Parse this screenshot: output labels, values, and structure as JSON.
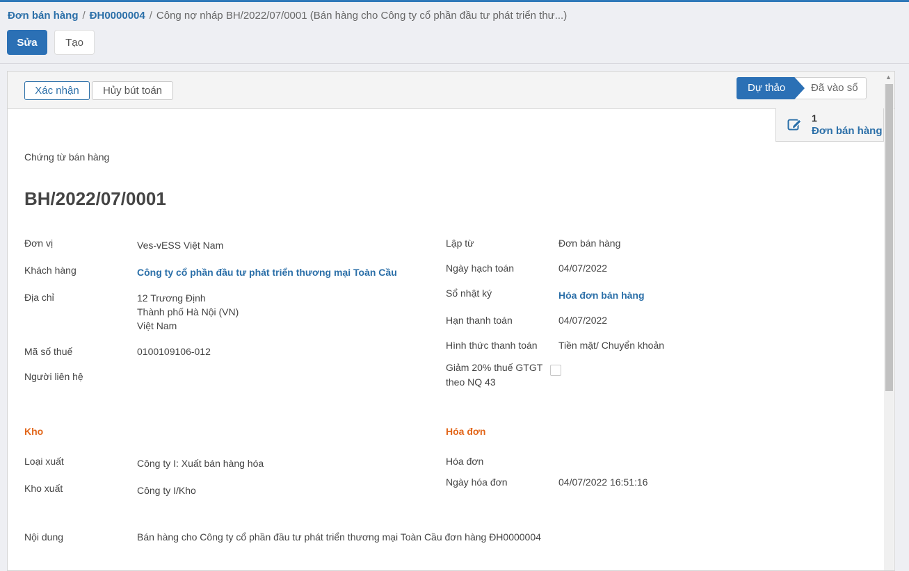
{
  "breadcrumb": {
    "item1": "Đơn bán hàng",
    "item2": "ĐH0000004",
    "current": "Công nợ nháp BH/2022/07/0001 (Bán hàng cho Công ty cổ phần đầu tư phát triển thư...)",
    "separator": "/"
  },
  "toolbar": {
    "edit_label": "Sửa",
    "create_label": "Tạo"
  },
  "statusbar": {
    "confirm_label": "Xác nhận",
    "cancel_label": "Hủy bút toán",
    "stages": {
      "draft": "Dự thảo",
      "posted": "Đã vào sổ"
    },
    "active_stage": "draft"
  },
  "smart_button": {
    "count": "1",
    "label": "Đơn bán hàng",
    "icon": "edit-icon"
  },
  "document": {
    "type_label": "Chứng từ bán hàng",
    "number": "BH/2022/07/0001",
    "left": {
      "unit_label": "Đơn vị",
      "unit_value": "Ves-vESS Việt Nam",
      "customer_label": "Khách hàng",
      "customer_value": "Công ty cổ phần đầu tư phát triển thương mại Toàn Cầu",
      "address_label": "Địa chỉ",
      "address_line1": "12 Trương Định",
      "address_line2": "Thành phố Hà Nội (VN)",
      "address_line3": "Việt Nam",
      "tax_label": "Mã số thuế",
      "tax_value": "0100109106-012",
      "contact_label": "Người liên hệ"
    },
    "right": {
      "created_from_label": "Lập từ",
      "created_from_value": "Đơn bán hàng",
      "accounting_date_label": "Ngày hạch toán",
      "accounting_date_value": "04/07/2022",
      "journal_label": "Sổ nhật ký",
      "journal_value": "Hóa đơn bán hàng",
      "due_date_label": "Hạn thanh toán",
      "due_date_value": "04/07/2022",
      "payment_method_label": "Hình thức thanh toán",
      "payment_method_value": "Tiền mặt/ Chuyển khoản",
      "vat_reduction_line1": "Giảm 20% thuế GTGT",
      "vat_reduction_line2": "theo NQ 43",
      "vat_reduction_checked": false
    },
    "warehouse": {
      "section_title": "Kho",
      "export_type_label": "Loại xuất",
      "export_type_value": "Công ty I: Xuất bán hàng hóa",
      "warehouse_label": "Kho xuất",
      "warehouse_value": "Công ty I/Kho"
    },
    "invoice": {
      "section_title": "Hóa đơn",
      "invoice_label": "Hóa đơn",
      "invoice_date_label": "Ngày hóa đơn",
      "invoice_date_value": "04/07/2022 16:51:16"
    },
    "content_label": "Nội dung",
    "content_value": "Bán hàng cho Công ty cổ phần đầu tư phát triển thương mại Toàn Cầu đơn hàng ĐH0000004"
  },
  "colors": {
    "primary": "#2b70b5",
    "link": "#2b6fa8",
    "section": "#e2661a"
  }
}
